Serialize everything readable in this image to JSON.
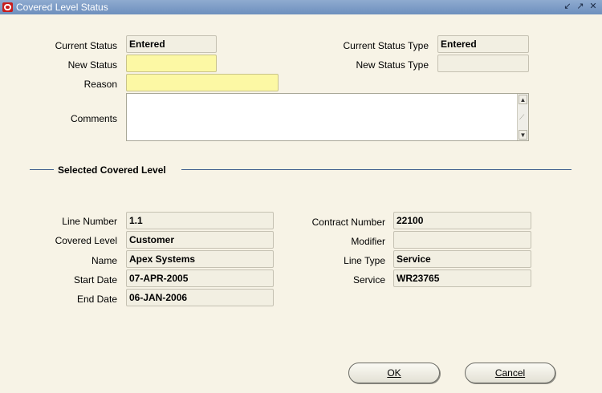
{
  "window": {
    "title": "Covered Level Status"
  },
  "status": {
    "current_status_label": "Current Status",
    "current_status_value": "Entered",
    "current_status_type_label": "Current Status Type",
    "current_status_type_value": "Entered",
    "new_status_label": "New Status",
    "new_status_value": "",
    "new_status_type_label": "New Status Type",
    "new_status_type_value": "",
    "reason_label": "Reason",
    "reason_value": "",
    "comments_label": "Comments",
    "comments_value": ""
  },
  "section": {
    "title": "Selected Covered Level"
  },
  "covered_level": {
    "line_number_label": "Line Number",
    "line_number_value": "1.1",
    "covered_level_label": "Covered Level",
    "covered_level_value": "Customer",
    "name_label": "Name",
    "name_value": "Apex Systems",
    "start_date_label": "Start Date",
    "start_date_value": "07-APR-2005",
    "end_date_label": "End Date",
    "end_date_value": "06-JAN-2006",
    "contract_number_label": "Contract Number",
    "contract_number_value": "22100",
    "modifier_label": "Modifier",
    "modifier_value": "",
    "line_type_label": "Line Type",
    "line_type_value": "Service",
    "service_label": "Service",
    "service_value": "WR23765"
  },
  "buttons": {
    "ok_label": "OK",
    "cancel_label": "Cancel"
  },
  "icons": {
    "app": "oracle-logo-icon",
    "window_controls": [
      "minimize-icon",
      "maximize-icon",
      "close-icon"
    ]
  },
  "colors": {
    "titlebar": "#7b9ac4",
    "required_field": "#fcf8a4",
    "background": "#f7f3e6"
  }
}
